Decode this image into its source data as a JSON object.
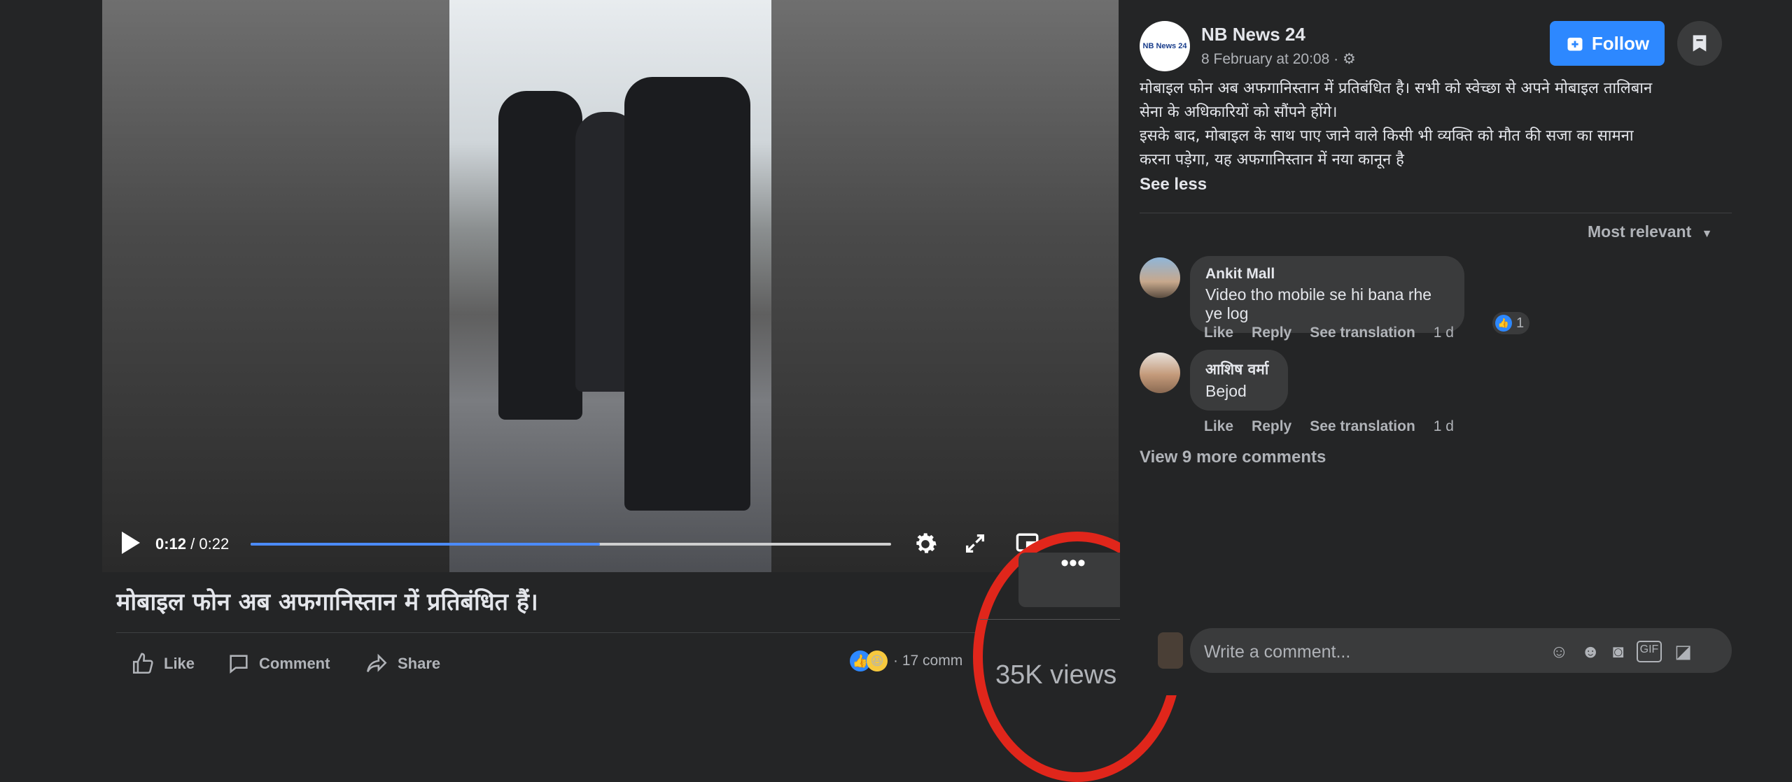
{
  "video": {
    "current_time": "0:12",
    "separator": "/",
    "duration": "0:22",
    "progress_fraction": 0.5455,
    "title": "मोबाइल फोन अब अफगानिस्तान में प्रतिबंधित हैं।"
  },
  "actions": {
    "like_label": "Like",
    "comment_label": "Comment",
    "share_label": "Share",
    "comments_count": "· 17 comm",
    "views": "35K views",
    "more_menu": "•••"
  },
  "post": {
    "page_name": "NB News 24",
    "timestamp": "8 February at 20:08 ·",
    "follow_label": "Follow",
    "text_lines": [
      "मोबाइल फोन अब अफगानिस्तान में प्रतिबंधित है। सभी को स्वेच्छा से अपने मोबाइल तालिबान",
      "सेना के अधिकारियों को सौंपने होंगे।",
      "इसके बाद, मोबाइल के साथ पाए जाने वाले किसी भी व्यक्ति को मौत की सजा का सामना",
      "करना पड़ेगा, यह अफगानिस्तान में नया कानून है"
    ],
    "see_less": "See less",
    "avatar_text": "NB News 24"
  },
  "comments": {
    "sort_label": "Most relevant",
    "items": [
      {
        "name": "Ankit Mall",
        "text": "Video tho mobile se hi bana rhe ye log",
        "like": "Like",
        "reply": "Reply",
        "translate": "See translation",
        "time": "1 d",
        "reactions": "1"
      },
      {
        "name": "आशिष वर्मा",
        "text": "Bejod",
        "like": "Like",
        "reply": "Reply",
        "translate": "See translation",
        "time": "1 d"
      }
    ],
    "view_more": "View 9 more comments",
    "write_placeholder": "Write a comment..."
  },
  "colors": {
    "accent": "#2d88ff",
    "progress": "#4b8bff",
    "highlight_circle": "#e0261b",
    "background": "#242526"
  },
  "icons": [
    "play-icon",
    "settings-icon",
    "fullscreen-icon",
    "pip-icon",
    "mute-icon",
    "like-icon",
    "comment-icon",
    "share-icon",
    "gear-icon",
    "follow-icon",
    "bookmark-icon",
    "sort-chevron-icon",
    "sticker-icon",
    "emoji-icon",
    "camera-icon",
    "gif-icon",
    "avatar-sticker-icon"
  ]
}
